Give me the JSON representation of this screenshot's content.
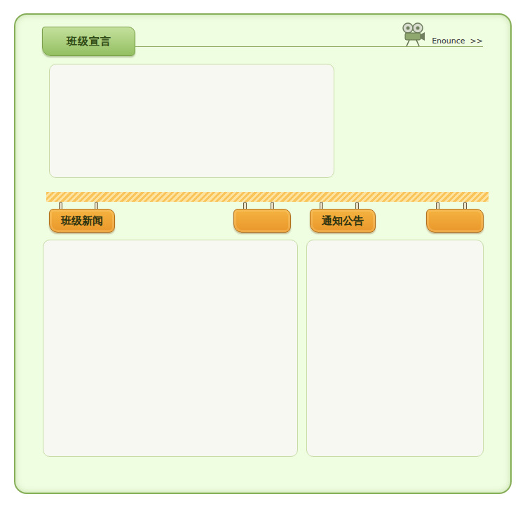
{
  "header": {
    "title": "班级宣言",
    "link": "Enounce  >>"
  },
  "sections": [
    {
      "title": "班级新闻"
    },
    {
      "title": "通知公告"
    }
  ]
}
